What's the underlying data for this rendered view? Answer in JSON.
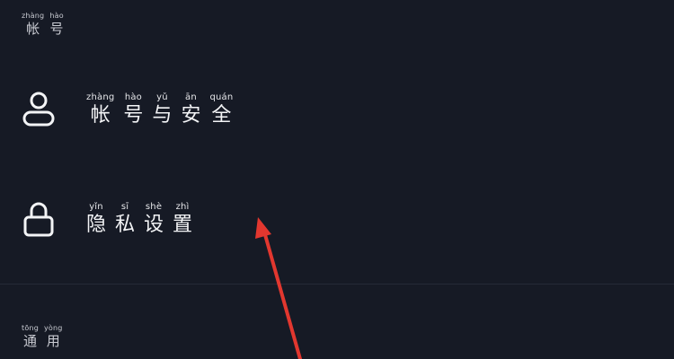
{
  "sections": {
    "account": {
      "title": [
        {
          "py": "zhàng",
          "hz": "帐"
        },
        {
          "py": "hào",
          "hz": "号"
        }
      ]
    },
    "general": {
      "title": [
        {
          "py": "tōng",
          "hz": "通"
        },
        {
          "py": "yòng",
          "hz": "用"
        }
      ]
    }
  },
  "items": {
    "account_security": {
      "icon": "user-icon",
      "chars": [
        {
          "py": "zhàng",
          "hz": "帐"
        },
        {
          "py": "hào",
          "hz": "号"
        },
        {
          "py": "yǔ",
          "hz": "与"
        },
        {
          "py": "ān",
          "hz": "安"
        },
        {
          "py": "quán",
          "hz": "全"
        }
      ]
    },
    "privacy_settings": {
      "icon": "lock-icon",
      "chars": [
        {
          "py": "yǐn",
          "hz": "隐"
        },
        {
          "py": "sī",
          "hz": "私"
        },
        {
          "py": "shè",
          "hz": "设"
        },
        {
          "py": "zhì",
          "hz": "置"
        }
      ]
    }
  },
  "colors": {
    "background": "#161a25",
    "text": "#f1f2f4",
    "annotation_arrow": "#e2372f"
  }
}
